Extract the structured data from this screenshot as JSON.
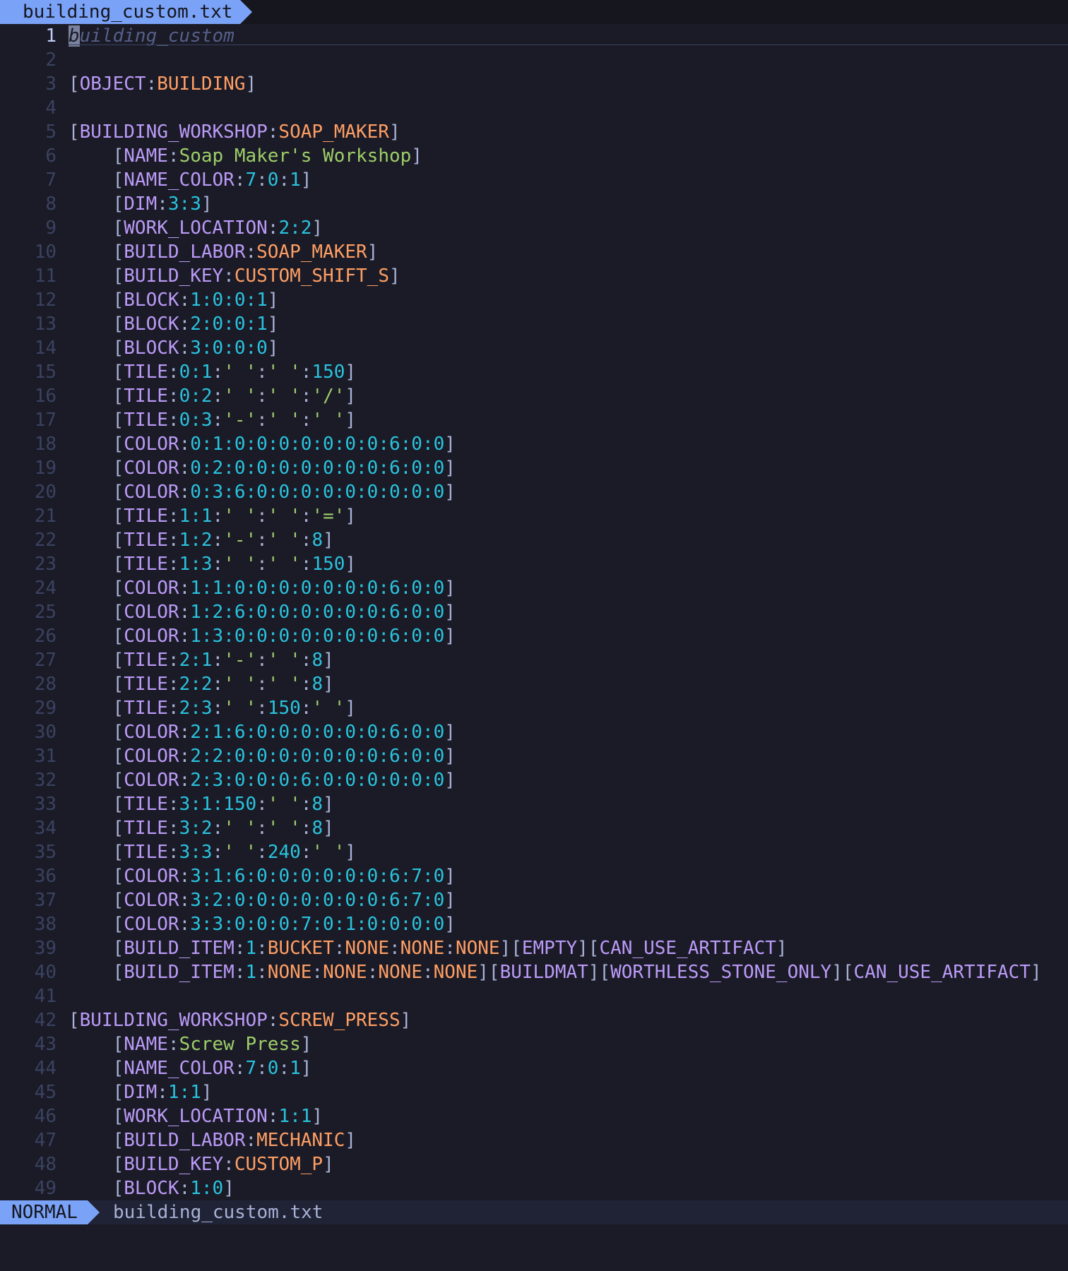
{
  "tabline": {
    "file": "building_custom.txt"
  },
  "statusline": {
    "mode": "NORMAL",
    "file": "building_custom.txt"
  },
  "colors": {
    "background": "#1a1b26",
    "tab_accent": "#7aa2f7",
    "tag_keyword": "#bb9af7",
    "identifier": "#ff9e64",
    "number": "#2ac3de",
    "string": "#9ece6a",
    "comment": "#565f89"
  },
  "cursor": {
    "line": 1,
    "column": 1
  },
  "lines": [
    [
      [
        "cm",
        "building_custom"
      ]
    ],
    [],
    [
      [
        "br",
        "["
      ],
      [
        "kw",
        "OBJECT"
      ],
      [
        "br",
        ":"
      ],
      [
        "id",
        "BUILDING"
      ],
      [
        "br",
        "]"
      ]
    ],
    [],
    [
      [
        "br",
        "["
      ],
      [
        "kw",
        "BUILDING_WORKSHOP"
      ],
      [
        "br",
        ":"
      ],
      [
        "id",
        "SOAP_MAKER"
      ],
      [
        "br",
        "]"
      ]
    ],
    [
      [
        "br",
        "    ["
      ],
      [
        "kw",
        "NAME"
      ],
      [
        "br",
        ":"
      ],
      [
        "str",
        "Soap Maker's Workshop"
      ],
      [
        "br",
        "]"
      ]
    ],
    [
      [
        "br",
        "    ["
      ],
      [
        "kw",
        "NAME_COLOR"
      ],
      [
        "br",
        ":"
      ],
      [
        "num",
        "7"
      ],
      [
        "br",
        ":"
      ],
      [
        "num",
        "0"
      ],
      [
        "br",
        ":"
      ],
      [
        "num",
        "1"
      ],
      [
        "br",
        "]"
      ]
    ],
    [
      [
        "br",
        "    ["
      ],
      [
        "kw",
        "DIM"
      ],
      [
        "br",
        ":"
      ],
      [
        "num",
        "3:3"
      ],
      [
        "br",
        "]"
      ]
    ],
    [
      [
        "br",
        "    ["
      ],
      [
        "kw",
        "WORK_LOCATION"
      ],
      [
        "br",
        ":"
      ],
      [
        "num",
        "2:2"
      ],
      [
        "br",
        "]"
      ]
    ],
    [
      [
        "br",
        "    ["
      ],
      [
        "kw",
        "BUILD_LABOR"
      ],
      [
        "br",
        ":"
      ],
      [
        "id",
        "SOAP_MAKER"
      ],
      [
        "br",
        "]"
      ]
    ],
    [
      [
        "br",
        "    ["
      ],
      [
        "kw",
        "BUILD_KEY"
      ],
      [
        "br",
        ":"
      ],
      [
        "id",
        "CUSTOM_SHIFT_S"
      ],
      [
        "br",
        "]"
      ]
    ],
    [
      [
        "br",
        "    ["
      ],
      [
        "kw",
        "BLOCK"
      ],
      [
        "br",
        ":"
      ],
      [
        "num",
        "1:0:0:1"
      ],
      [
        "br",
        "]"
      ]
    ],
    [
      [
        "br",
        "    ["
      ],
      [
        "kw",
        "BLOCK"
      ],
      [
        "br",
        ":"
      ],
      [
        "num",
        "2:0:0:1"
      ],
      [
        "br",
        "]"
      ]
    ],
    [
      [
        "br",
        "    ["
      ],
      [
        "kw",
        "BLOCK"
      ],
      [
        "br",
        ":"
      ],
      [
        "num",
        "3:0:0:0"
      ],
      [
        "br",
        "]"
      ]
    ],
    [
      [
        "br",
        "    ["
      ],
      [
        "kw",
        "TILE"
      ],
      [
        "br",
        ":"
      ],
      [
        "num",
        "0:1"
      ],
      [
        "br",
        ":"
      ],
      [
        "str",
        "' '"
      ],
      [
        "br",
        ":"
      ],
      [
        "str",
        "' '"
      ],
      [
        "br",
        ":"
      ],
      [
        "num",
        "150"
      ],
      [
        "br",
        "]"
      ]
    ],
    [
      [
        "br",
        "    ["
      ],
      [
        "kw",
        "TILE"
      ],
      [
        "br",
        ":"
      ],
      [
        "num",
        "0:2"
      ],
      [
        "br",
        ":"
      ],
      [
        "str",
        "' '"
      ],
      [
        "br",
        ":"
      ],
      [
        "str",
        "' '"
      ],
      [
        "br",
        ":"
      ],
      [
        "str",
        "'/'"
      ],
      [
        "br",
        "]"
      ]
    ],
    [
      [
        "br",
        "    ["
      ],
      [
        "kw",
        "TILE"
      ],
      [
        "br",
        ":"
      ],
      [
        "num",
        "0:3"
      ],
      [
        "br",
        ":"
      ],
      [
        "str",
        "'-'"
      ],
      [
        "br",
        ":"
      ],
      [
        "str",
        "' '"
      ],
      [
        "br",
        ":"
      ],
      [
        "str",
        "' '"
      ],
      [
        "br",
        "]"
      ]
    ],
    [
      [
        "br",
        "    ["
      ],
      [
        "kw",
        "COLOR"
      ],
      [
        "br",
        ":"
      ],
      [
        "num",
        "0:1:0:0:0:0:0:0:0:6:0:0"
      ],
      [
        "br",
        "]"
      ]
    ],
    [
      [
        "br",
        "    ["
      ],
      [
        "kw",
        "COLOR"
      ],
      [
        "br",
        ":"
      ],
      [
        "num",
        "0:2:0:0:0:0:0:0:0:6:0:0"
      ],
      [
        "br",
        "]"
      ]
    ],
    [
      [
        "br",
        "    ["
      ],
      [
        "kw",
        "COLOR"
      ],
      [
        "br",
        ":"
      ],
      [
        "num",
        "0:3:6:0:0:0:0:0:0:0:0:0"
      ],
      [
        "br",
        "]"
      ]
    ],
    [
      [
        "br",
        "    ["
      ],
      [
        "kw",
        "TILE"
      ],
      [
        "br",
        ":"
      ],
      [
        "num",
        "1:1"
      ],
      [
        "br",
        ":"
      ],
      [
        "str",
        "' '"
      ],
      [
        "br",
        ":"
      ],
      [
        "str",
        "' '"
      ],
      [
        "br",
        ":"
      ],
      [
        "str",
        "'='"
      ],
      [
        "br",
        "]"
      ]
    ],
    [
      [
        "br",
        "    ["
      ],
      [
        "kw",
        "TILE"
      ],
      [
        "br",
        ":"
      ],
      [
        "num",
        "1:2"
      ],
      [
        "br",
        ":"
      ],
      [
        "str",
        "'-'"
      ],
      [
        "br",
        ":"
      ],
      [
        "str",
        "' '"
      ],
      [
        "br",
        ":"
      ],
      [
        "num",
        "8"
      ],
      [
        "br",
        "]"
      ]
    ],
    [
      [
        "br",
        "    ["
      ],
      [
        "kw",
        "TILE"
      ],
      [
        "br",
        ":"
      ],
      [
        "num",
        "1:3"
      ],
      [
        "br",
        ":"
      ],
      [
        "str",
        "' '"
      ],
      [
        "br",
        ":"
      ],
      [
        "str",
        "' '"
      ],
      [
        "br",
        ":"
      ],
      [
        "num",
        "150"
      ],
      [
        "br",
        "]"
      ]
    ],
    [
      [
        "br",
        "    ["
      ],
      [
        "kw",
        "COLOR"
      ],
      [
        "br",
        ":"
      ],
      [
        "num",
        "1:1:0:0:0:0:0:0:0:6:0:0"
      ],
      [
        "br",
        "]"
      ]
    ],
    [
      [
        "br",
        "    ["
      ],
      [
        "kw",
        "COLOR"
      ],
      [
        "br",
        ":"
      ],
      [
        "num",
        "1:2:6:0:0:0:0:0:0:6:0:0"
      ],
      [
        "br",
        "]"
      ]
    ],
    [
      [
        "br",
        "    ["
      ],
      [
        "kw",
        "COLOR"
      ],
      [
        "br",
        ":"
      ],
      [
        "num",
        "1:3:0:0:0:0:0:0:0:6:0:0"
      ],
      [
        "br",
        "]"
      ]
    ],
    [
      [
        "br",
        "    ["
      ],
      [
        "kw",
        "TILE"
      ],
      [
        "br",
        ":"
      ],
      [
        "num",
        "2:1"
      ],
      [
        "br",
        ":"
      ],
      [
        "str",
        "'-'"
      ],
      [
        "br",
        ":"
      ],
      [
        "str",
        "' '"
      ],
      [
        "br",
        ":"
      ],
      [
        "num",
        "8"
      ],
      [
        "br",
        "]"
      ]
    ],
    [
      [
        "br",
        "    ["
      ],
      [
        "kw",
        "TILE"
      ],
      [
        "br",
        ":"
      ],
      [
        "num",
        "2:2"
      ],
      [
        "br",
        ":"
      ],
      [
        "str",
        "' '"
      ],
      [
        "br",
        ":"
      ],
      [
        "str",
        "' '"
      ],
      [
        "br",
        ":"
      ],
      [
        "num",
        "8"
      ],
      [
        "br",
        "]"
      ]
    ],
    [
      [
        "br",
        "    ["
      ],
      [
        "kw",
        "TILE"
      ],
      [
        "br",
        ":"
      ],
      [
        "num",
        "2:3"
      ],
      [
        "br",
        ":"
      ],
      [
        "str",
        "' '"
      ],
      [
        "br",
        ":"
      ],
      [
        "num",
        "150"
      ],
      [
        "br",
        ":"
      ],
      [
        "str",
        "' '"
      ],
      [
        "br",
        "]"
      ]
    ],
    [
      [
        "br",
        "    ["
      ],
      [
        "kw",
        "COLOR"
      ],
      [
        "br",
        ":"
      ],
      [
        "num",
        "2:1:6:0:0:0:0:0:0:6:0:0"
      ],
      [
        "br",
        "]"
      ]
    ],
    [
      [
        "br",
        "    ["
      ],
      [
        "kw",
        "COLOR"
      ],
      [
        "br",
        ":"
      ],
      [
        "num",
        "2:2:0:0:0:0:0:0:0:6:0:0"
      ],
      [
        "br",
        "]"
      ]
    ],
    [
      [
        "br",
        "    ["
      ],
      [
        "kw",
        "COLOR"
      ],
      [
        "br",
        ":"
      ],
      [
        "num",
        "2:3:0:0:0:6:0:0:0:0:0:0"
      ],
      [
        "br",
        "]"
      ]
    ],
    [
      [
        "br",
        "    ["
      ],
      [
        "kw",
        "TILE"
      ],
      [
        "br",
        ":"
      ],
      [
        "num",
        "3:1:150"
      ],
      [
        "br",
        ":"
      ],
      [
        "str",
        "' '"
      ],
      [
        "br",
        ":"
      ],
      [
        "num",
        "8"
      ],
      [
        "br",
        "]"
      ]
    ],
    [
      [
        "br",
        "    ["
      ],
      [
        "kw",
        "TILE"
      ],
      [
        "br",
        ":"
      ],
      [
        "num",
        "3:2"
      ],
      [
        "br",
        ":"
      ],
      [
        "str",
        "' '"
      ],
      [
        "br",
        ":"
      ],
      [
        "str",
        "' '"
      ],
      [
        "br",
        ":"
      ],
      [
        "num",
        "8"
      ],
      [
        "br",
        "]"
      ]
    ],
    [
      [
        "br",
        "    ["
      ],
      [
        "kw",
        "TILE"
      ],
      [
        "br",
        ":"
      ],
      [
        "num",
        "3:3"
      ],
      [
        "br",
        ":"
      ],
      [
        "str",
        "' '"
      ],
      [
        "br",
        ":"
      ],
      [
        "num",
        "240"
      ],
      [
        "br",
        ":"
      ],
      [
        "str",
        "' '"
      ],
      [
        "br",
        "]"
      ]
    ],
    [
      [
        "br",
        "    ["
      ],
      [
        "kw",
        "COLOR"
      ],
      [
        "br",
        ":"
      ],
      [
        "num",
        "3:1:6:0:0:0:0:0:0:6:7:0"
      ],
      [
        "br",
        "]"
      ]
    ],
    [
      [
        "br",
        "    ["
      ],
      [
        "kw",
        "COLOR"
      ],
      [
        "br",
        ":"
      ],
      [
        "num",
        "3:2:0:0:0:0:0:0:0:6:7:0"
      ],
      [
        "br",
        "]"
      ]
    ],
    [
      [
        "br",
        "    ["
      ],
      [
        "kw",
        "COLOR"
      ],
      [
        "br",
        ":"
      ],
      [
        "num",
        "3:3:0:0:0:7:0:1:0:0:0:0"
      ],
      [
        "br",
        "]"
      ]
    ],
    [
      [
        "br",
        "    ["
      ],
      [
        "kw",
        "BUILD_ITEM"
      ],
      [
        "br",
        ":"
      ],
      [
        "num",
        "1"
      ],
      [
        "br",
        ":"
      ],
      [
        "id",
        "BUCKET"
      ],
      [
        "br",
        ":"
      ],
      [
        "id",
        "NONE"
      ],
      [
        "br",
        ":"
      ],
      [
        "id",
        "NONE"
      ],
      [
        "br",
        ":"
      ],
      [
        "id",
        "NONE"
      ],
      [
        "br",
        "]["
      ],
      [
        "kw",
        "EMPTY"
      ],
      [
        "br",
        "]["
      ],
      [
        "kw",
        "CAN_USE_ARTIFACT"
      ],
      [
        "br",
        "]"
      ]
    ],
    [
      [
        "br",
        "    ["
      ],
      [
        "kw",
        "BUILD_ITEM"
      ],
      [
        "br",
        ":"
      ],
      [
        "num",
        "1"
      ],
      [
        "br",
        ":"
      ],
      [
        "id",
        "NONE"
      ],
      [
        "br",
        ":"
      ],
      [
        "id",
        "NONE"
      ],
      [
        "br",
        ":"
      ],
      [
        "id",
        "NONE"
      ],
      [
        "br",
        ":"
      ],
      [
        "id",
        "NONE"
      ],
      [
        "br",
        "]["
      ],
      [
        "kw",
        "BUILDMAT"
      ],
      [
        "br",
        "]["
      ],
      [
        "kw",
        "WORTHLESS_STONE_ONLY"
      ],
      [
        "br",
        "]["
      ],
      [
        "kw",
        "CAN_USE_ARTIFACT"
      ],
      [
        "br",
        "]"
      ]
    ],
    [],
    [
      [
        "br",
        "["
      ],
      [
        "kw",
        "BUILDING_WORKSHOP"
      ],
      [
        "br",
        ":"
      ],
      [
        "id",
        "SCREW_PRESS"
      ],
      [
        "br",
        "]"
      ]
    ],
    [
      [
        "br",
        "    ["
      ],
      [
        "kw",
        "NAME"
      ],
      [
        "br",
        ":"
      ],
      [
        "str",
        "Screw Press"
      ],
      [
        "br",
        "]"
      ]
    ],
    [
      [
        "br",
        "    ["
      ],
      [
        "kw",
        "NAME_COLOR"
      ],
      [
        "br",
        ":"
      ],
      [
        "num",
        "7"
      ],
      [
        "br",
        ":"
      ],
      [
        "num",
        "0"
      ],
      [
        "br",
        ":"
      ],
      [
        "num",
        "1"
      ],
      [
        "br",
        "]"
      ]
    ],
    [
      [
        "br",
        "    ["
      ],
      [
        "kw",
        "DIM"
      ],
      [
        "br",
        ":"
      ],
      [
        "num",
        "1:1"
      ],
      [
        "br",
        "]"
      ]
    ],
    [
      [
        "br",
        "    ["
      ],
      [
        "kw",
        "WORK_LOCATION"
      ],
      [
        "br",
        ":"
      ],
      [
        "num",
        "1:1"
      ],
      [
        "br",
        "]"
      ]
    ],
    [
      [
        "br",
        "    ["
      ],
      [
        "kw",
        "BUILD_LABOR"
      ],
      [
        "br",
        ":"
      ],
      [
        "id",
        "MECHANIC"
      ],
      [
        "br",
        "]"
      ]
    ],
    [
      [
        "br",
        "    ["
      ],
      [
        "kw",
        "BUILD_KEY"
      ],
      [
        "br",
        ":"
      ],
      [
        "id",
        "CUSTOM_P"
      ],
      [
        "br",
        "]"
      ]
    ],
    [
      [
        "br",
        "    ["
      ],
      [
        "kw",
        "BLOCK"
      ],
      [
        "br",
        ":"
      ],
      [
        "num",
        "1:0"
      ],
      [
        "br",
        "]"
      ]
    ]
  ]
}
